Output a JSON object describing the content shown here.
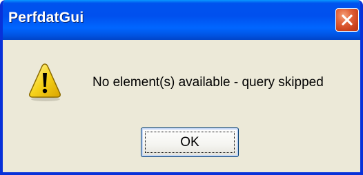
{
  "window": {
    "title": "PerfdatGui",
    "close_icon": "close-icon",
    "title_color": "#0054e3"
  },
  "content": {
    "icon": "warning-icon",
    "message": "No element(s) available - query skipped"
  },
  "buttons": {
    "ok_label": "OK"
  }
}
